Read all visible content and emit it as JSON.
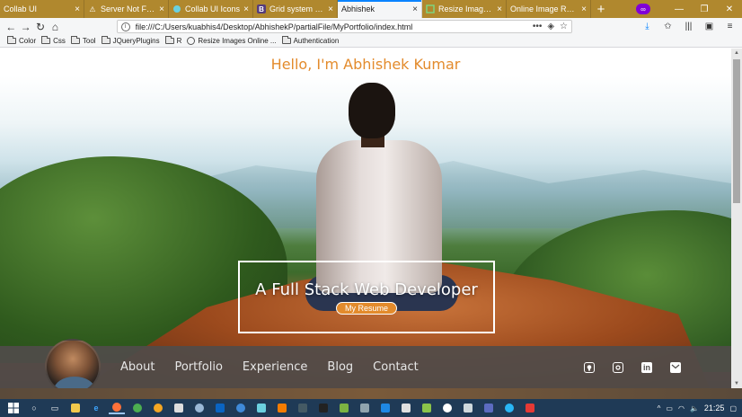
{
  "browser": {
    "tabs": [
      {
        "title": "Collab UI",
        "icon": "",
        "active": false
      },
      {
        "title": "Server Not Found",
        "icon": "warning",
        "active": false
      },
      {
        "title": "Collab UI Icons",
        "icon": "collab",
        "active": false
      },
      {
        "title": "Grid system · Bo",
        "icon": "B",
        "active": false
      },
      {
        "title": "Abhishek",
        "icon": "",
        "active": true
      },
      {
        "title": "Resize Images O",
        "icon": "resize",
        "active": false
      },
      {
        "title": "Online Image Resize",
        "icon": "",
        "active": false
      }
    ],
    "close_glyph": "×",
    "new_tab_glyph": "+",
    "url": "file:///C:/Users/kuabhis4/Desktop/AbhishekP/partialFile/MyPortfolio/index.html",
    "bookmarks": [
      {
        "label": "Color",
        "type": "folder"
      },
      {
        "label": "Css",
        "type": "folder"
      },
      {
        "label": "Tool",
        "type": "folder"
      },
      {
        "label": "JQueryPlugins",
        "type": "folder"
      },
      {
        "label": "R",
        "type": "folder"
      },
      {
        "label": "Resize Images Online ...",
        "type": "link"
      },
      {
        "label": "Authentication",
        "type": "folder"
      }
    ]
  },
  "page": {
    "hero_title": "Hello, I'm Abhishek Kumar",
    "hero_subtitle": "A Full Stack Web Developer",
    "resume_button": "My Resume",
    "nav_links": [
      "About",
      "Portfolio",
      "Experience",
      "Blog",
      "Contact"
    ],
    "social_icons": [
      "github-icon",
      "instagram-icon",
      "linkedin-icon",
      "email-icon"
    ],
    "accent_color": "#e38b2c"
  },
  "taskbar": {
    "time": "21:25"
  }
}
